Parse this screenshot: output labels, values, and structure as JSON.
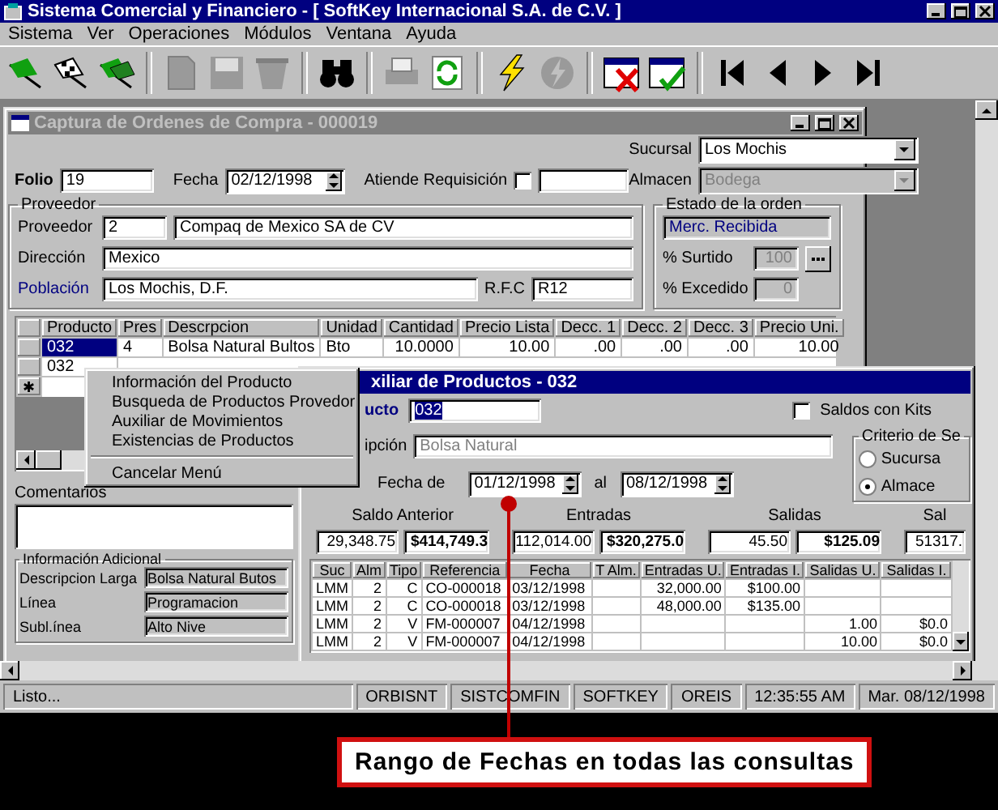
{
  "window": {
    "title": "Sistema Comercial y Financiero  - [ SoftKey Internacional S.A. de C.V. ]"
  },
  "menu": [
    "Sistema",
    "Ver",
    "Operaciones",
    "Módulos",
    "Ventana",
    "Ayuda"
  ],
  "toolbar": [
    {
      "kind": "flag",
      "disabled": false
    },
    {
      "kind": "checkered-flag",
      "disabled": false
    },
    {
      "kind": "flags",
      "disabled": false
    },
    {
      "kind": "sep"
    },
    {
      "kind": "document",
      "disabled": true
    },
    {
      "kind": "floppy",
      "disabled": true
    },
    {
      "kind": "bin",
      "disabled": true
    },
    {
      "kind": "sep"
    },
    {
      "kind": "binoculars",
      "disabled": false
    },
    {
      "kind": "sep"
    },
    {
      "kind": "printer",
      "disabled": true
    },
    {
      "kind": "refresh",
      "disabled": false
    },
    {
      "kind": "sep"
    },
    {
      "kind": "lightning",
      "disabled": false
    },
    {
      "kind": "disc",
      "disabled": true
    },
    {
      "kind": "sep"
    },
    {
      "kind": "window-x",
      "disabled": false
    },
    {
      "kind": "window-check",
      "disabled": false
    },
    {
      "kind": "sep"
    },
    {
      "kind": "first",
      "disabled": false
    },
    {
      "kind": "previous",
      "disabled": false
    },
    {
      "kind": "next",
      "disabled": false
    },
    {
      "kind": "last",
      "disabled": false
    }
  ],
  "order_window": {
    "title": "Captura de Ordenes de Compra - 000019",
    "sucursal": {
      "label": "Sucursal",
      "value": "Los Mochis"
    },
    "almacen": {
      "label": "Almacen",
      "value": "Bodega",
      "disabled": true
    },
    "folio": {
      "label": "Folio",
      "value": "19"
    },
    "fecha": {
      "label": "Fecha",
      "value": "02/12/1998"
    },
    "atiende": {
      "label": "Atiende Requisición",
      "checked": false
    },
    "proveedor": {
      "title": "Proveedor",
      "label": "Proveedor",
      "code": "2",
      "name": "Compaq de Mexico SA de CV",
      "direccion_label": "Dirección",
      "direccion": "Mexico",
      "poblacion_label": "Población",
      "poblacion": "Los Mochis, D.F.",
      "rfc_label": "R.F.C",
      "rfc": "R12"
    },
    "estado": {
      "title": "Estado de la orden",
      "status": "Merc. Recibida",
      "surtido_label": "% Surtido",
      "surtido": "100",
      "excedido_label": "% Excedido",
      "excedido": "0"
    },
    "grid": {
      "columns": [
        "Producto",
        "Pres",
        "Descrpcion",
        "Unidad",
        "Cantidad",
        "Precio Lista",
        "Decc. 1",
        "Decc. 2",
        "Decc. 3",
        "Precio Uni."
      ],
      "rows": [
        {
          "cells": [
            "032",
            "4",
            "Bolsa Natural Bultos",
            "Bto",
            "10.0000",
            "10.00",
            ".00",
            ".00",
            ".00",
            "10.00"
          ],
          "selected": true
        },
        {
          "cells": [
            "032"
          ],
          "selected": false
        }
      ],
      "new_row_marker": "✱"
    },
    "comentarios_label": "Comentarios",
    "info": {
      "title": "Información Adicional",
      "fields": [
        {
          "label": "Descripcion Larga",
          "value": "Bolsa Natural Butos"
        },
        {
          "label": "Línea",
          "value": "Programacion"
        },
        {
          "label": "Subl.ínea",
          "value": "Alto Nive"
        }
      ]
    }
  },
  "aux_window": {
    "title": "xiliar de Productos - 032",
    "producto_label": "ucto",
    "producto": "032",
    "kits": {
      "label": "Saldos con Kits",
      "checked": false
    },
    "descripcion_label": "ipción",
    "descripcion": "Bolsa Natural",
    "fecha_label": "Fecha de",
    "desde": "01/12/1998",
    "al_label": "al",
    "hasta": "08/12/1998",
    "criterio": {
      "title": "Criterio de Se",
      "options": [
        {
          "label": "Sucursa",
          "selected": false
        },
        {
          "label": "Almace",
          "selected": true
        }
      ]
    },
    "totals": [
      {
        "label": "Saldo Anterior",
        "units": "29,348.75",
        "amount": "$414,749.3"
      },
      {
        "label": "Entradas",
        "units": "112,014.00",
        "amount": "$320,275.0"
      },
      {
        "label": "Salidas",
        "units": "45.50",
        "amount": "$125.09"
      },
      {
        "label": "Sal",
        "units": "51317."
      }
    ],
    "table": {
      "columns": [
        "Suc",
        "Alm",
        "Tipo",
        "Referencia",
        "Fecha",
        "T Alm.",
        "Entradas U.",
        "Entradas I.",
        "Salidas U.",
        "Salidas I."
      ],
      "rows": [
        [
          "LMM",
          "2",
          "C",
          "CO-000018",
          "03/12/1998",
          null,
          "32,000.00",
          "$100.00",
          null,
          null
        ],
        [
          "LMM",
          "2",
          "C",
          "CO-000018",
          "03/12/1998",
          null,
          "48,000.00",
          "$135.00",
          null,
          null
        ],
        [
          "LMM",
          "2",
          "V",
          "FM-000007",
          "04/12/1998",
          null,
          null,
          null,
          "1.00",
          "$0.0"
        ],
        [
          "LMM",
          "2",
          "V",
          "FM-000007",
          "04/12/1998",
          null,
          null,
          null,
          "10.00",
          "$0.0"
        ]
      ]
    }
  },
  "popup_menu": [
    {
      "kind": "item",
      "label": "Información del Producto"
    },
    {
      "kind": "item",
      "label": "Busqueda de Productos Provedor"
    },
    {
      "kind": "item",
      "label": "Auxiliar de Movimientos"
    },
    {
      "kind": "item",
      "label": "Existencias de Productos"
    },
    {
      "kind": "separator"
    },
    {
      "kind": "item",
      "label": "Cancelar Menú"
    }
  ],
  "status_bar": [
    "Listo...",
    "ORBISNT",
    "SISTCOMFIN",
    "SOFTKEY",
    "OREIS",
    "12:35:55 AM",
    "Mar. 08/12/1998"
  ],
  "callout": {
    "text": "Rango de Fechas en todas las consultas"
  }
}
